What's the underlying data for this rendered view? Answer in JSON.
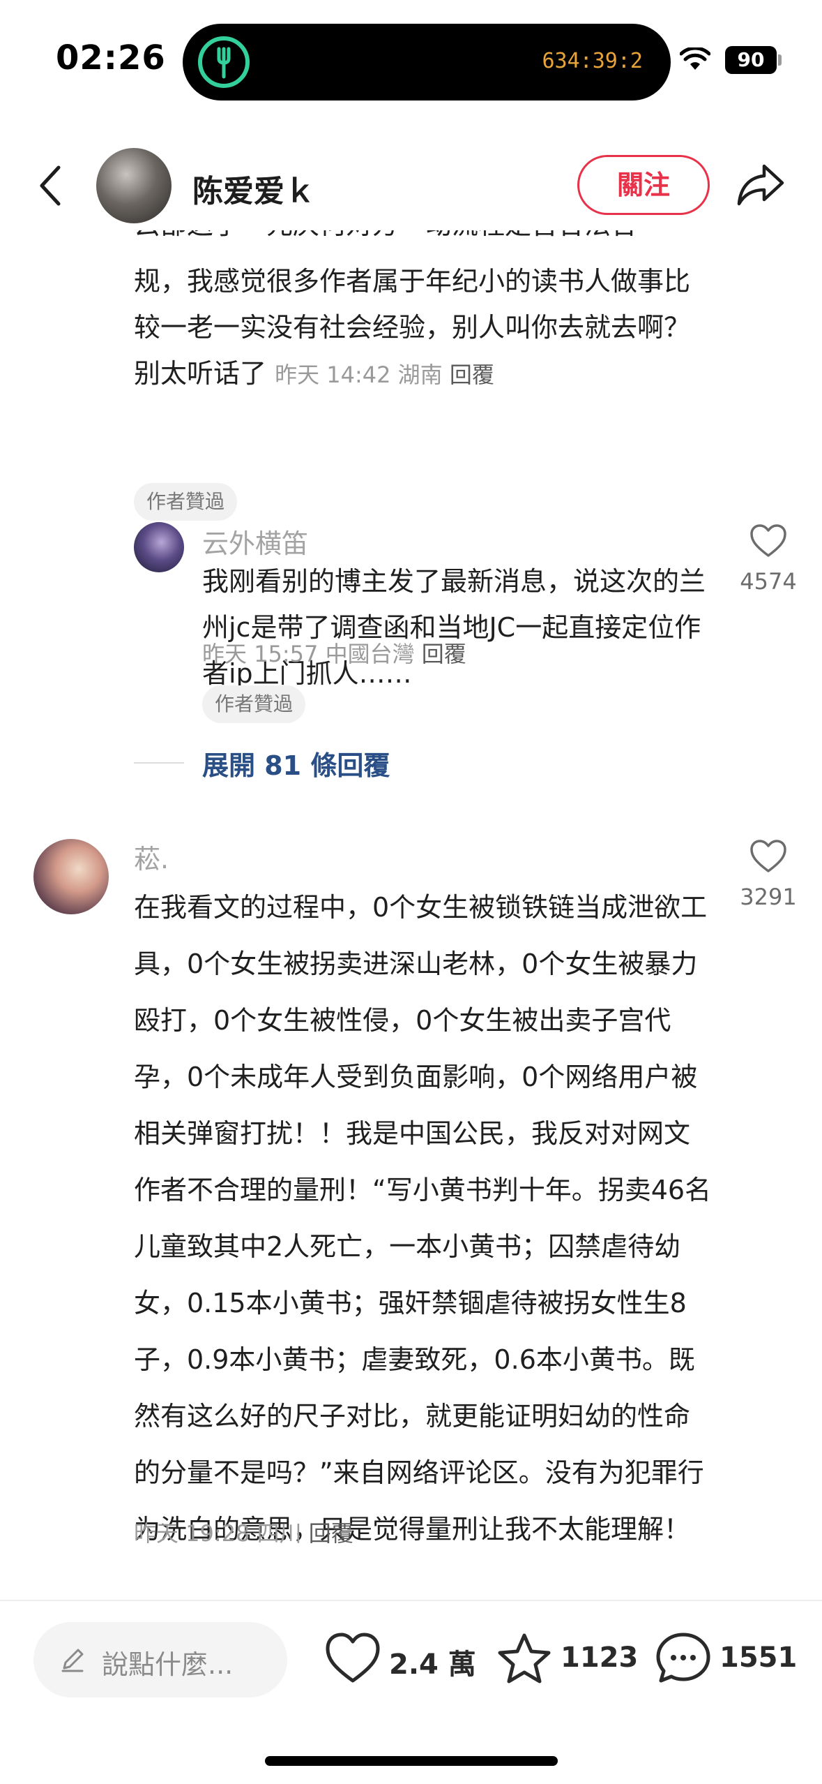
{
  "status_bar": {
    "time": "02:26",
    "island_timer": "634:39:2",
    "battery": "90"
  },
  "header": {
    "author_name": "陈爱爱ｋ",
    "follow_label": "關注"
  },
  "comments": {
    "c1": {
      "partial_line": "云部这了一元庆何对方一动流程是否合法合",
      "text": "规，我感觉很多作者属于年纪小的读书人做事比较一老一实没有社会经验，别人叫你去就去啊？别太听话了",
      "meta_time": "昨天 14:42 湖南",
      "reply_label": "回覆",
      "tag": "作者贊過"
    },
    "r1": {
      "name": "云外横笛",
      "text": "我刚看别的博主发了最新消息，说这次的兰州jc是带了调查函和当地JC一起直接定位作者ip上门抓人……",
      "meta_time": "昨天 15:57 中國台灣",
      "reply_label": "回覆",
      "tag": "作者贊過",
      "likes": "4574"
    },
    "expand_label": "展開 81 條回覆",
    "c2": {
      "name": "菘.",
      "text": "在我看文的过程中，0个女生被锁铁链当成泄欲工具，0个女生被拐卖进深山老林，0个女生被暴力殴打，0个女生被性侵，0个女生被出卖子宫代孕，0个未成年人受到负面影响，0个网络用户被相关弹窗打扰！！我是中国公民，我反对对网文作者不合理的量刑！“写小黄书判十年。拐卖46名儿童致其中2人死亡，一本小黄书；囚禁虐待幼女，0.15本小黄书；强奸禁锢虐待被拐女性生8子，0.9本小黄书；虐妻致死，0.6本小黄书。既然有这么好的尺子对比，就更能证明妇幼的性命的分量不是吗？”来自网络评论区。没有为犯罪行为洗白的意思，只是觉得量刑让我不太能理解！",
      "meta_time": "昨天 19:28 四川",
      "reply_label": "回覆",
      "likes": "3291"
    }
  },
  "bottom_bar": {
    "input_placeholder": "說點什麼...",
    "likes": "2.4 萬",
    "favorites": "1123",
    "comments": "1551"
  },
  "colors": {
    "accent": "#e8324a",
    "link": "#2a4f86",
    "island_app": "#33d09c",
    "timer": "#e8a33a"
  }
}
